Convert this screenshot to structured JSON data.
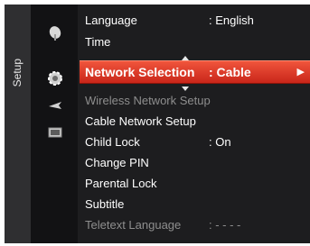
{
  "sidebar": {
    "title": "Setup"
  },
  "icons": [
    "satellite-dish-icon",
    "gear-icon",
    "plane-icon",
    "tv-input-icon"
  ],
  "menu": {
    "rows": [
      {
        "label": "Language",
        "value": ": English"
      },
      {
        "label": "Time",
        "value": ""
      },
      {
        "label": "Network Selection",
        "value": ": Cable"
      },
      {
        "label": "Wireless Network Setup",
        "value": ""
      },
      {
        "label": "Cable Network Setup",
        "value": ""
      },
      {
        "label": "Child Lock",
        "value": ": On"
      },
      {
        "label": "Change PIN",
        "value": ""
      },
      {
        "label": "Parental Lock",
        "value": ""
      },
      {
        "label": "Subtitle",
        "value": ""
      },
      {
        "label": "Teletext Language",
        "value": ": - - - -"
      }
    ],
    "selected_arrow": "▶"
  },
  "colors": {
    "panel": "#1d1d1f",
    "highlight_top": "#f0553c",
    "highlight_bottom": "#c9261a",
    "text": "#ffffff",
    "disabled_text": "#8e8e8e"
  }
}
